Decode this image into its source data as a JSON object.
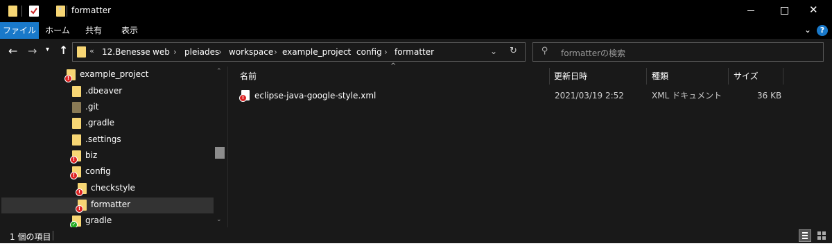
{
  "window": {
    "title": "formatter"
  },
  "ribbon": {
    "tabs": [
      "ファイル",
      "ホーム",
      "共有",
      "表示"
    ]
  },
  "breadcrumb": {
    "overflow": "«",
    "items": [
      "12.Benesse",
      "web",
      "pleiades",
      "workspace",
      "example_project",
      "config",
      "formatter"
    ]
  },
  "search": {
    "placeholder": "formatterの検索"
  },
  "tree": {
    "items": [
      {
        "label": "example_project"
      },
      {
        "label": ".dbeaver"
      },
      {
        "label": ".git"
      },
      {
        "label": ".gradle"
      },
      {
        "label": ".settings"
      },
      {
        "label": "biz"
      },
      {
        "label": "config"
      },
      {
        "label": "checkstyle"
      },
      {
        "label": "formatter"
      },
      {
        "label": "gradle"
      }
    ]
  },
  "columns": {
    "name": "名前",
    "modified": "更新日時",
    "type": "種類",
    "size": "サイズ"
  },
  "files": [
    {
      "name": "eclipse-java-google-style.xml",
      "modified": "2021/03/19 2:52",
      "type": "XML ドキュメント",
      "size": "36 KB"
    }
  ],
  "status": {
    "count": "1 個の項目"
  },
  "colors": {
    "accent": "#1979ca",
    "background": "#191919",
    "folder": "#f7d674",
    "selection": "#333333"
  }
}
